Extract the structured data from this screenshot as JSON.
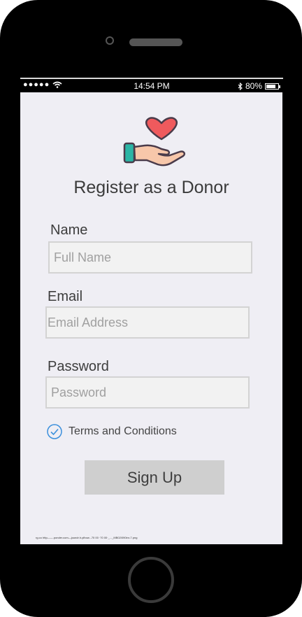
{
  "status": {
    "signal": "●●●●●",
    "time": "14:54 PM",
    "battery_percent": "80%",
    "battery_level": 0.8
  },
  "title": "Register as a Donor",
  "form": {
    "name_label": "Name",
    "name_placeholder": "Full Name",
    "email_label": "Email",
    "email_placeholder": "Email Address",
    "password_label": "Password",
    "password_placeholder": "Password",
    "terms_label": "Terms and Conditions",
    "terms_checked": true,
    "signup_label": "Sign Up"
  },
  "source_text": "rg.co  http——.ponder.com—joundr.h-yfbow...70 00 ·70 00·_..._MB02/090inr-7.png",
  "icons": {
    "logo": "hand-heart-icon",
    "check": "check-circle-icon",
    "wifi": "wifi-icon",
    "bluetooth": "bluetooth-icon",
    "battery": "battery-icon"
  },
  "colors": {
    "heart": "#ef5a5d",
    "cuff": "#2bb5a5",
    "check": "#3b8fdc",
    "background": "#efeef4"
  }
}
